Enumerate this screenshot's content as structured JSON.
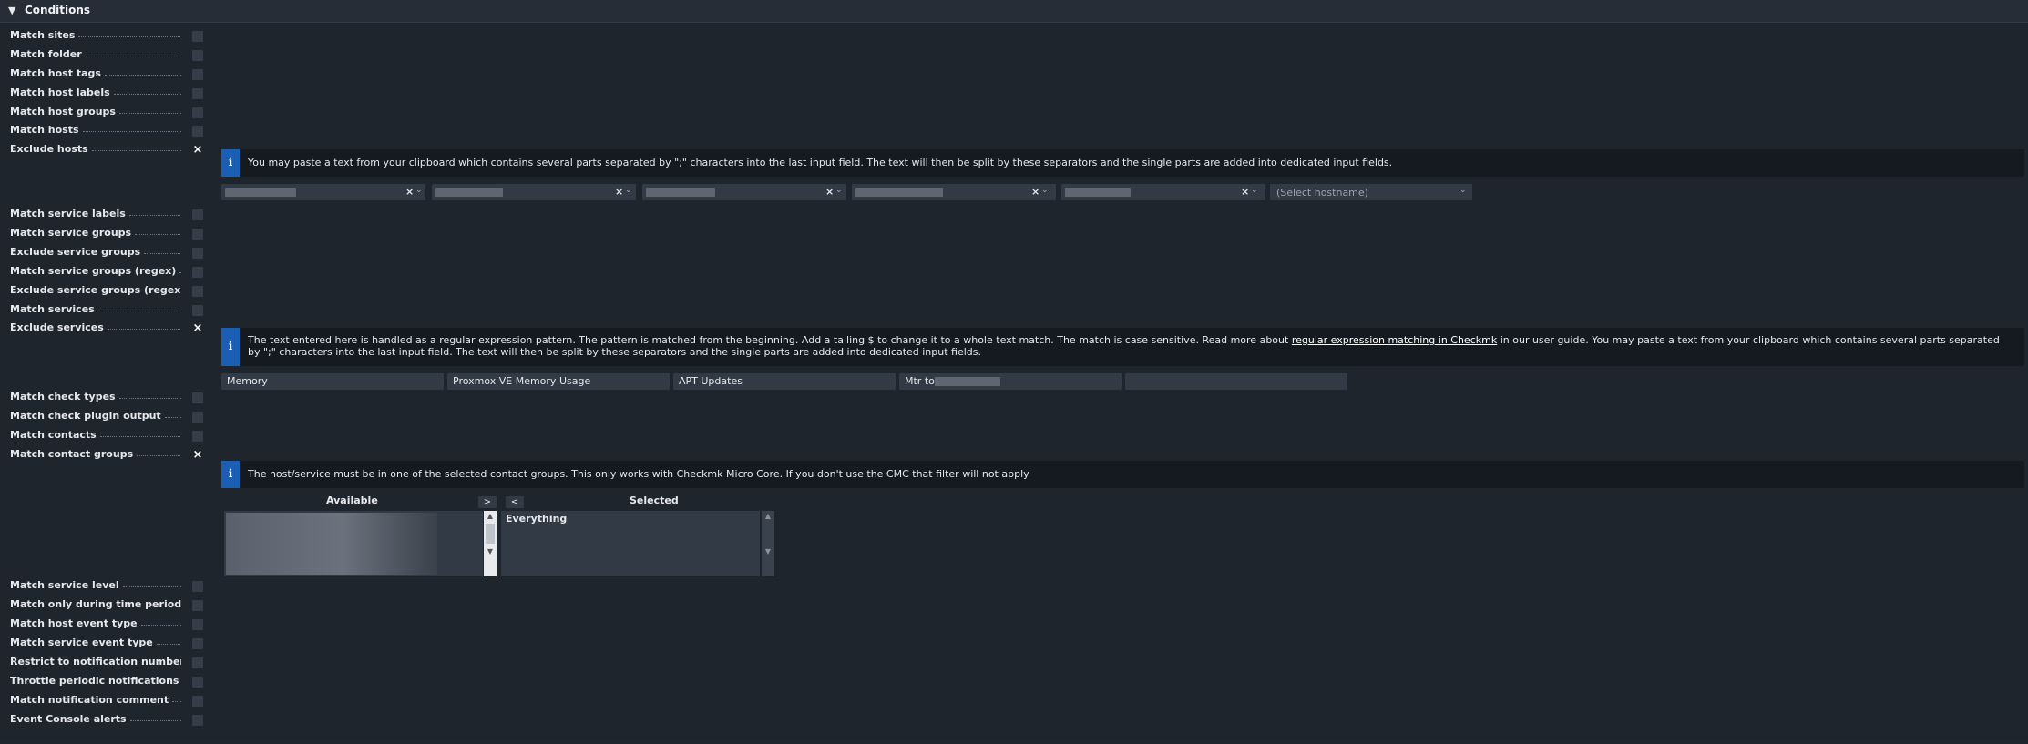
{
  "section": {
    "title": "Conditions",
    "toggle_icon": "triangle-down-icon"
  },
  "conditions": [
    {
      "label": "Match sites",
      "checked": false
    },
    {
      "label": "Match folder",
      "checked": false
    },
    {
      "label": "Match host tags",
      "checked": false
    },
    {
      "label": "Match host labels",
      "checked": false
    },
    {
      "label": "Match host groups",
      "checked": false
    },
    {
      "label": "Match hosts",
      "checked": false
    },
    {
      "label": "Exclude hosts",
      "checked": true
    },
    {
      "label": "Match service labels",
      "checked": false
    },
    {
      "label": "Match service groups",
      "checked": false
    },
    {
      "label": "Exclude service groups",
      "checked": false
    },
    {
      "label": "Match service groups (regex)",
      "checked": false
    },
    {
      "label": "Exclude service groups (regex)",
      "checked": false
    },
    {
      "label": "Match services",
      "checked": false
    },
    {
      "label": "Exclude services",
      "checked": true
    },
    {
      "label": "Match check types",
      "checked": false
    },
    {
      "label": "Match check plugin output",
      "checked": false
    },
    {
      "label": "Match contacts",
      "checked": false
    },
    {
      "label": "Match contact groups",
      "checked": true
    },
    {
      "label": "Match service level",
      "checked": false
    },
    {
      "label": "Match only during time period",
      "checked": false
    },
    {
      "label": "Match host event type",
      "checked": false
    },
    {
      "label": "Match service event type",
      "checked": false
    },
    {
      "label": "Restrict to notification number",
      "checked": false
    },
    {
      "label": "Throttle periodic notifications",
      "checked": false
    },
    {
      "label": "Match notification comment",
      "checked": false
    },
    {
      "label": "Event Console alerts",
      "checked": false
    }
  ],
  "checkmark_glyph": "×",
  "exclude_hosts": {
    "info": "You may paste a text from your clipboard which contains several parts separated by \";\" characters into the last input field. The text will then be split by these separators and the single parts are added into dedicated input fields.",
    "hostnames_redacted": 5,
    "placeholder": "(Select hostname)",
    "clear_glyph": "×",
    "caret_glyph": "⌄"
  },
  "exclude_services": {
    "info_before_link": "The text entered here is handled as a regular expression pattern. The pattern is matched from the beginning. Add a tailing $ to change it to a whole text match. The match is case sensitive. Read more about ",
    "link_text": "regular expression matching in Checkmk",
    "info_after_link": " in our user guide. You may paste a text from your clipboard which contains several parts separated by \";\" characters into the last input field. The text will then be split by these separators and the single parts are added into dedicated input fields.",
    "patterns": [
      "Memory",
      "Proxmox VE Memory Usage",
      "APT Updates",
      "Mtr to",
      ""
    ]
  },
  "contact_groups": {
    "info": "The host/service must be in one of the selected contact groups. This only works with Checkmk Micro Core. If you don't use the CMC that filter will not apply",
    "available_label": "Available",
    "selected_label": "Selected",
    "add_button": ">",
    "remove_button": "<",
    "selected_items": [
      "Everything"
    ]
  },
  "info_icon": "i"
}
